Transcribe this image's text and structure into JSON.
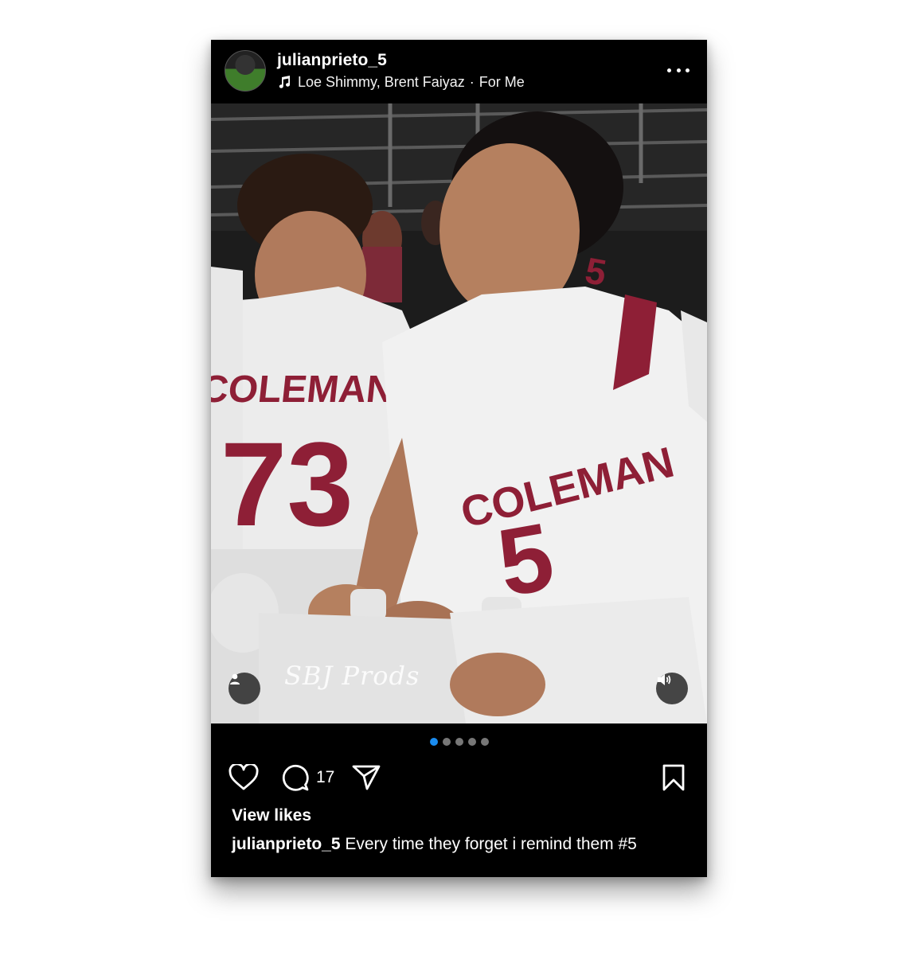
{
  "post": {
    "username": "julianprieto_5",
    "music": {
      "artists": "Loe Shimmy, Brent Faiyaz",
      "separator": "·",
      "song": "For Me"
    },
    "photo": {
      "watermark": "SBJ Prods",
      "jersey_left": {
        "team": "COLEMAN",
        "number": "73"
      },
      "jersey_right": {
        "team": "COLEMAN",
        "number": "5",
        "shoulder_number": "5"
      }
    },
    "carousel": {
      "total": 5,
      "active_index": 0
    },
    "comment_count": "17",
    "likes_label": "View likes",
    "caption_username": "julianprieto_5",
    "caption_text": "Every time they forget i remind them #5"
  },
  "colors": {
    "background": "#000000",
    "accent_dot": "#1a8cf0",
    "jersey_maroon": "#8e1f36"
  },
  "icons": [
    "music-note-icon",
    "more-icon",
    "person-tag-icon",
    "speaker-icon",
    "heart-icon",
    "comment-icon",
    "send-icon",
    "bookmark-icon"
  ]
}
